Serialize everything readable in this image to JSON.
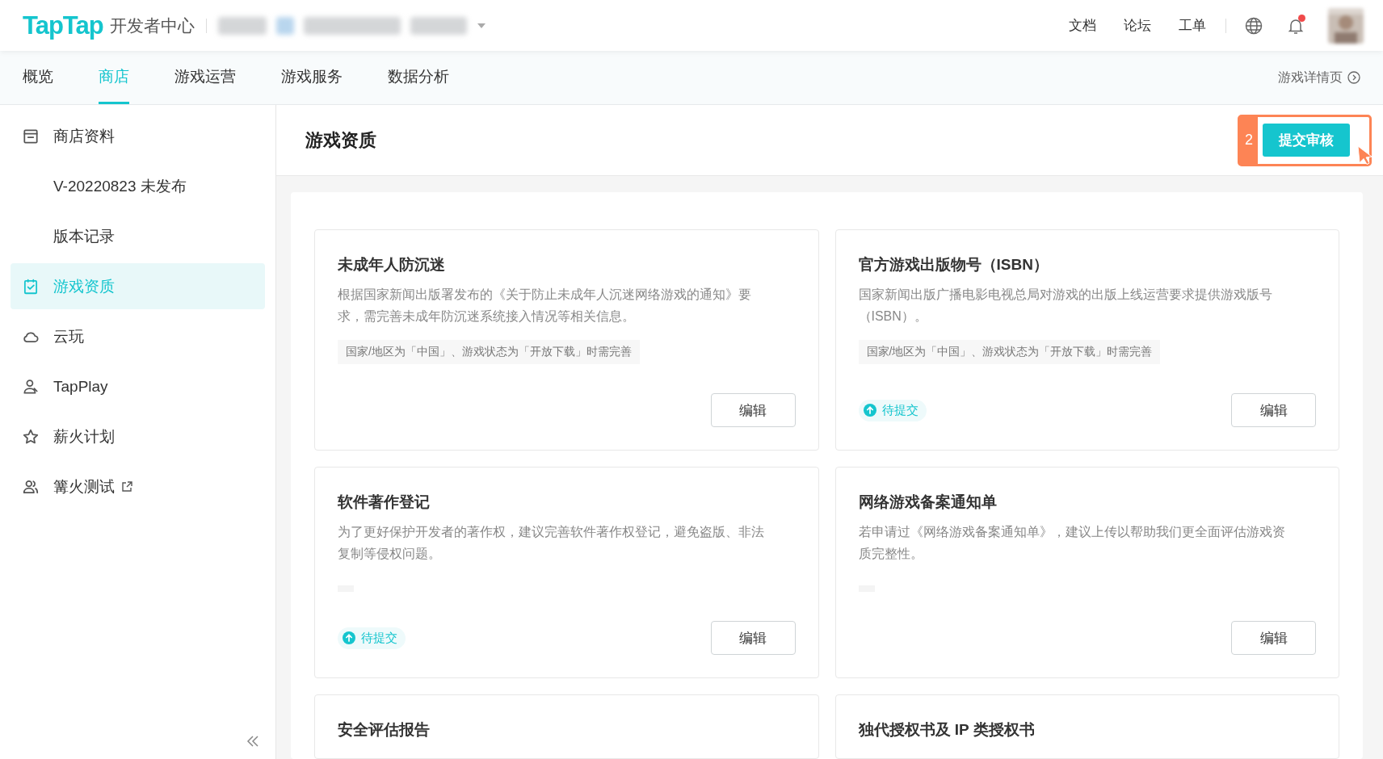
{
  "header": {
    "logo": "TapTap",
    "product": "开发者中心",
    "links": [
      "文档",
      "论坛",
      "工单"
    ],
    "notification_dot": true
  },
  "tabs": [
    {
      "label": "概览",
      "selected": false
    },
    {
      "label": "商店",
      "selected": true
    },
    {
      "label": "游戏运营",
      "selected": false
    },
    {
      "label": "游戏服务",
      "selected": false
    },
    {
      "label": "数据分析",
      "selected": false
    }
  ],
  "detail_link": "游戏详情页",
  "sidebar": {
    "items": [
      {
        "kind": "store",
        "label": "商店资料",
        "selected": false,
        "children": [
          {
            "label": "V-20220823 未发布",
            "selected": false
          },
          {
            "label": "版本记录",
            "selected": false
          }
        ]
      },
      {
        "kind": "clipboard",
        "label": "游戏资质",
        "selected": true
      },
      {
        "kind": "cloud",
        "label": "云玩",
        "selected": false
      },
      {
        "kind": "person",
        "label": "TapPlay",
        "selected": false
      },
      {
        "kind": "star",
        "label": "薪火计划",
        "selected": false
      },
      {
        "kind": "people",
        "label": "篝火测试",
        "selected": false,
        "external": true
      }
    ]
  },
  "page": {
    "title": "游戏资质",
    "step": "2",
    "submit": "提交审核"
  },
  "cards": [
    {
      "title": "未成年人防沉迷",
      "description": "根据国家新闻出版署发布的《关于防止未成年人沉迷网络游戏的通知》要求，需完善未成年防沉迷系统接入情况等相关信息。",
      "note": "国家/地区为「中国」、游戏状态为「开放下载」时需完善",
      "edit": "编辑"
    },
    {
      "title": "官方游戏出版物号（ISBN）",
      "description": "国家新闻出版广播电影电视总局对游戏的出版上线运营要求提供游戏版号（ISBN）。",
      "note": "国家/地区为「中国」、游戏状态为「开放下载」时需完善",
      "status": "待提交",
      "edit": "编辑"
    },
    {
      "title": "软件著作登记",
      "description": "为了更好保护开发者的著作权，建议完善软件著作权登记，避免盗版、非法复制等侵权问题。",
      "note_blank": true,
      "status": "待提交",
      "edit": "编辑"
    },
    {
      "title": "网络游戏备案通知单",
      "description": "若申请过《网络游戏备案通知单》，建议上传以帮助我们更全面评估游戏资质完整性。",
      "note_blank": true,
      "edit": "编辑"
    },
    {
      "title": "安全评估报告"
    },
    {
      "title": "独代授权书及 IP 类授权书"
    }
  ]
}
